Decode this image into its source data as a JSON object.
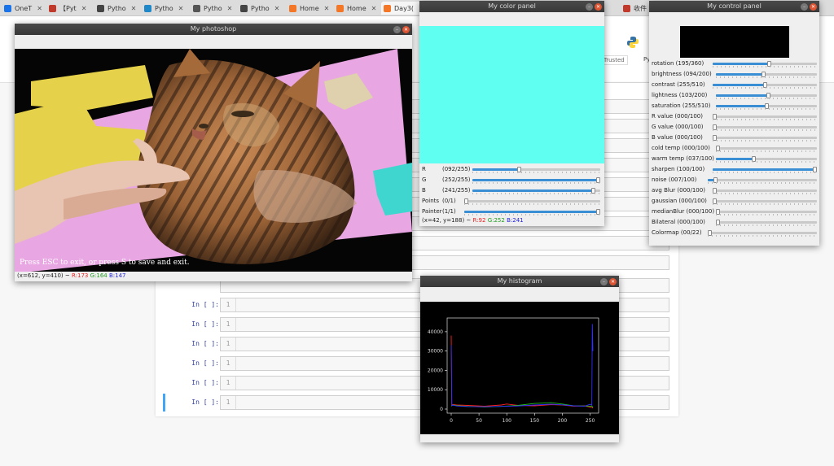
{
  "tabs": [
    {
      "label": "OneT",
      "fav": "#1a73e8"
    },
    {
      "label": "【Pyt",
      "fav": "#c0392b"
    },
    {
      "label": "Pytho",
      "fav": "#444444"
    },
    {
      "label": "Pytho",
      "fav": "#1e88c8"
    },
    {
      "label": "Pytho",
      "fav": "#555555"
    },
    {
      "label": "Pytho",
      "fav": "#444444"
    },
    {
      "label": "Home",
      "fav": "#f37726"
    },
    {
      "label": "Home",
      "fav": "#f37726"
    },
    {
      "label": "Day3(",
      "fav": "#f37726"
    },
    {
      "label": "收件",
      "fav": "#c0392b"
    }
  ],
  "browser": {
    "trusted": "Trusted",
    "kernel": "Py"
  },
  "notebook": {
    "prompt": "In [ ]:",
    "line": "1"
  },
  "photoshop": {
    "title": "My photoshop",
    "overlay": "Press ESC to exit, or press S to save and exit.",
    "coords": "(x=612, y=410) ~",
    "r": "R:173",
    "g": "G:164",
    "b": "B:147"
  },
  "color_panel": {
    "title": "My color panel",
    "swatch": "#5ffff1",
    "sliders": [
      {
        "label": "R",
        "value": "(092/255)",
        "v": 92,
        "max": 255
      },
      {
        "label": "G",
        "value": "(252/255)",
        "v": 252,
        "max": 255
      },
      {
        "label": "B",
        "value": "(241/255)",
        "v": 241,
        "max": 255
      },
      {
        "label": "Points",
        "value": "(0/1)",
        "v": 0,
        "max": 1
      },
      {
        "label": "Painter",
        "value": "(1/1)",
        "v": 1,
        "max": 1
      }
    ],
    "coords": "(x=42, y=188) ~",
    "r": "R:92",
    "g": "G:252",
    "b": "B:241"
  },
  "control_panel": {
    "title": "My control panel",
    "sliders": [
      {
        "label": "rotation  (195/360)",
        "v": 195,
        "max": 360
      },
      {
        "label": "brightness (094/200)",
        "v": 94,
        "max": 200
      },
      {
        "label": "contrast  (255/510)",
        "v": 255,
        "max": 510
      },
      {
        "label": "lightness  (103/200)",
        "v": 103,
        "max": 200
      },
      {
        "label": "saturation (255/510)",
        "v": 255,
        "max": 510
      },
      {
        "label": "R value   (000/100)",
        "v": 0,
        "max": 100
      },
      {
        "label": "G value   (000/100)",
        "v": 0,
        "max": 100
      },
      {
        "label": "B value   (000/100)",
        "v": 0,
        "max": 100
      },
      {
        "label": "cold temp  (000/100)",
        "v": 0,
        "max": 100
      },
      {
        "label": "warm temp  (037/100)",
        "v": 37,
        "max": 100
      },
      {
        "label": "sharpen   (100/100)",
        "v": 100,
        "max": 100
      },
      {
        "label": "noise   (007/100)",
        "v": 7,
        "max": 100
      },
      {
        "label": "avg Blur  (000/100)",
        "v": 0,
        "max": 100
      },
      {
        "label": "gaussian  (000/100)",
        "v": 0,
        "max": 100
      },
      {
        "label": "medianBlur (000/100)",
        "v": 0,
        "max": 100
      },
      {
        "label": "Bilateral  (000/100)",
        "v": 0,
        "max": 100
      },
      {
        "label": "Colormap  (00/22)",
        "v": 0,
        "max": 22
      }
    ]
  },
  "histogram": {
    "title": "My histogram",
    "chart_data": {
      "type": "line",
      "title": "",
      "xlabel": "",
      "ylabel": "",
      "xlim": [
        0,
        255
      ],
      "ylim": [
        0,
        45000
      ],
      "xticks": [
        0,
        50,
        100,
        150,
        200,
        250
      ],
      "yticks": [
        0,
        10000,
        20000,
        30000,
        40000
      ],
      "series": [
        {
          "color": "#ff2020",
          "x": [
            0,
            1,
            3,
            10,
            30,
            60,
            90,
            100,
            120,
            150,
            180,
            200,
            220,
            240,
            252,
            254,
            255
          ],
          "values": [
            38000,
            2000,
            2400,
            2100,
            1900,
            1500,
            2100,
            2600,
            1900,
            1700,
            2300,
            2100,
            1500,
            1700,
            900,
            800,
            500
          ]
        },
        {
          "color": "#20c020",
          "x": [
            0,
            1,
            3,
            10,
            30,
            60,
            90,
            120,
            150,
            180,
            200,
            220,
            240,
            252,
            254,
            255
          ],
          "values": [
            1500,
            1800,
            2100,
            1800,
            1400,
            1100,
            1400,
            1900,
            2900,
            3300,
            2600,
            1700,
            1600,
            1500,
            1300,
            900
          ]
        },
        {
          "color": "#3030ff",
          "x": [
            0,
            1,
            3,
            10,
            30,
            60,
            90,
            120,
            150,
            180,
            200,
            220,
            240,
            250,
            253,
            254,
            255
          ],
          "values": [
            33000,
            1800,
            2000,
            1600,
            1300,
            1200,
            1400,
            1600,
            2100,
            2500,
            2200,
            1700,
            1500,
            2500,
            2000,
            44000,
            30000
          ]
        }
      ]
    }
  }
}
